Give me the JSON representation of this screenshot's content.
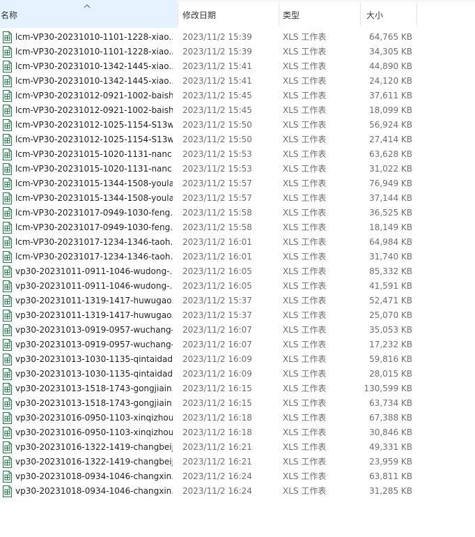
{
  "columns": {
    "name": "名称",
    "modified": "修改日期",
    "type": "类型",
    "size": "大小"
  },
  "sort": {
    "column": "name",
    "direction": "ascending",
    "icon": "sort-up-arrow-icon"
  },
  "file_icon": "excel-file-icon",
  "accent_color": "#1d7a45",
  "files": [
    {
      "name": "lcm-VP30-20231010-1101-1228-xiao...",
      "modified": "2023/11/2 15:39",
      "type": "XLS 工作表",
      "size": "64,765 KB"
    },
    {
      "name": "lcm-VP30-20231010-1101-1228-xiao...",
      "modified": "2023/11/2 15:39",
      "type": "XLS 工作表",
      "size": "34,305 KB"
    },
    {
      "name": "lcm-VP30-20231010-1342-1445-xiao...",
      "modified": "2023/11/2 15:41",
      "type": "XLS 工作表",
      "size": "44,890 KB"
    },
    {
      "name": "lcm-VP30-20231010-1342-1445-xiao...",
      "modified": "2023/11/2 15:41",
      "type": "XLS 工作表",
      "size": "24,120 KB"
    },
    {
      "name": "lcm-VP30-20231012-0921-1002-baish...",
      "modified": "2023/11/2 15:45",
      "type": "XLS 工作表",
      "size": "37,611 KB"
    },
    {
      "name": "lcm-VP30-20231012-0921-1002-baish...",
      "modified": "2023/11/2 15:45",
      "type": "XLS 工作表",
      "size": "18,099 KB"
    },
    {
      "name": "lcm-VP30-20231012-1025-1154-S13w...",
      "modified": "2023/11/2 15:50",
      "type": "XLS 工作表",
      "size": "56,924 KB"
    },
    {
      "name": "lcm-VP30-20231012-1025-1154-S13w...",
      "modified": "2023/11/2 15:50",
      "type": "XLS 工作表",
      "size": "27,414 KB"
    },
    {
      "name": "lcm-VP30-20231015-1020-1131-nanc...",
      "modified": "2023/11/2 15:53",
      "type": "XLS 工作表",
      "size": "63,628 KB"
    },
    {
      "name": "lcm-VP30-20231015-1020-1131-nanc...",
      "modified": "2023/11/2 15:53",
      "type": "XLS 工作表",
      "size": "31,022 KB"
    },
    {
      "name": "lcm-VP30-20231015-1344-1508-youla...",
      "modified": "2023/11/2 15:57",
      "type": "XLS 工作表",
      "size": "76,949 KB"
    },
    {
      "name": "lcm-VP30-20231015-1344-1508-youla...",
      "modified": "2023/11/2 15:57",
      "type": "XLS 工作表",
      "size": "37,144 KB"
    },
    {
      "name": "lcm-VP30-20231017-0949-1030-feng...",
      "modified": "2023/11/2 15:58",
      "type": "XLS 工作表",
      "size": "36,525 KB"
    },
    {
      "name": "lcm-VP30-20231017-0949-1030-feng...",
      "modified": "2023/11/2 15:58",
      "type": "XLS 工作表",
      "size": "18,149 KB"
    },
    {
      "name": "lcm-VP30-20231017-1234-1346-taoh...",
      "modified": "2023/11/2 16:01",
      "type": "XLS 工作表",
      "size": "64,984 KB"
    },
    {
      "name": "lcm-VP30-20231017-1234-1346-taoh...",
      "modified": "2023/11/2 16:01",
      "type": "XLS 工作表",
      "size": "31,740 KB"
    },
    {
      "name": "vp30-20231011-0911-1046-wudong-...",
      "modified": "2023/11/2 16:05",
      "type": "XLS 工作表",
      "size": "85,332 KB"
    },
    {
      "name": "vp30-20231011-0911-1046-wudong-...",
      "modified": "2023/11/2 16:05",
      "type": "XLS 工作表",
      "size": "41,591 KB"
    },
    {
      "name": "vp30-20231011-1319-1417-huwugao...",
      "modified": "2023/11/2 15:37",
      "type": "XLS 工作表",
      "size": "52,471 KB"
    },
    {
      "name": "vp30-20231011-1319-1417-huwugao...",
      "modified": "2023/11/2 15:37",
      "type": "XLS 工作表",
      "size": "25,070 KB"
    },
    {
      "name": "vp30-20231013-0919-0957-wuchang-...",
      "modified": "2023/11/2 16:07",
      "type": "XLS 工作表",
      "size": "35,053 KB"
    },
    {
      "name": "vp30-20231013-0919-0957-wuchang-...",
      "modified": "2023/11/2 16:07",
      "type": "XLS 工作表",
      "size": "17,232 KB"
    },
    {
      "name": "vp30-20231013-1030-1135-qintaidad...",
      "modified": "2023/11/2 16:09",
      "type": "XLS 工作表",
      "size": "59,816 KB"
    },
    {
      "name": "vp30-20231013-1030-1135-qintaidad...",
      "modified": "2023/11/2 16:09",
      "type": "XLS 工作表",
      "size": "28,015 KB"
    },
    {
      "name": "vp30-20231013-1518-1743-gongjiain...",
      "modified": "2023/11/2 16:15",
      "type": "XLS 工作表",
      "size": "130,599 KB"
    },
    {
      "name": "vp30-20231013-1518-1743-gongjiain...",
      "modified": "2023/11/2 16:15",
      "type": "XLS 工作表",
      "size": "63,734 KB"
    },
    {
      "name": "vp30-20231016-0950-1103-xinqizhou...",
      "modified": "2023/11/2 16:18",
      "type": "XLS 工作表",
      "size": "67,388 KB"
    },
    {
      "name": "vp30-20231016-0950-1103-xinqizhou...",
      "modified": "2023/11/2 16:18",
      "type": "XLS 工作表",
      "size": "30,846 KB"
    },
    {
      "name": "vp30-20231016-1322-1419-changbeij...",
      "modified": "2023/11/2 16:21",
      "type": "XLS 工作表",
      "size": "49,331 KB"
    },
    {
      "name": "vp30-20231016-1322-1419-changbeij...",
      "modified": "2023/11/2 16:21",
      "type": "XLS 工作表",
      "size": "23,959 KB"
    },
    {
      "name": "vp30-20231018-0934-1046-changxin...",
      "modified": "2023/11/2 16:24",
      "type": "XLS 工作表",
      "size": "63,811 KB"
    },
    {
      "name": "vp30-20231018-0934-1046-changxin...",
      "modified": "2023/11/2 16:24",
      "type": "XLS 工作表",
      "size": "31,285 KB"
    }
  ]
}
